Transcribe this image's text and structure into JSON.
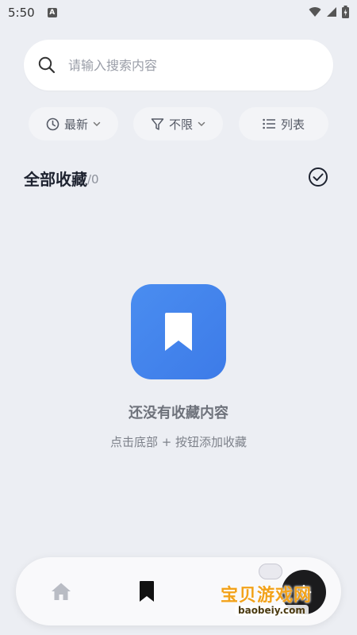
{
  "status_bar": {
    "time": "5:50",
    "notification_badge": "A",
    "icons": [
      "wifi-icon",
      "signal-icon",
      "battery-icon"
    ]
  },
  "search": {
    "placeholder": "请输入搜索内容",
    "icon": "search-icon"
  },
  "filters": {
    "sort_label": "最新",
    "filter_label": "不限",
    "view_label": "列表"
  },
  "section": {
    "title": "全部收藏",
    "count": "/0"
  },
  "empty_state": {
    "title": "还没有收藏内容",
    "subtitle": "点击底部 + 按钮添加收藏",
    "icon": "bookmark-icon"
  },
  "bottom_nav": {
    "items": [
      {
        "icon": "home-icon",
        "active": false
      },
      {
        "icon": "bookmark-icon",
        "active": true
      },
      {
        "icon": "plus-icon",
        "active": false
      }
    ]
  },
  "watermark": {
    "text": "宝贝游戏网",
    "url": "baobeiy.com"
  },
  "colors": {
    "background": "#eceef3",
    "accent": "#4a8df0",
    "text_primary": "#1e2330",
    "text_secondary": "#7d818a"
  }
}
